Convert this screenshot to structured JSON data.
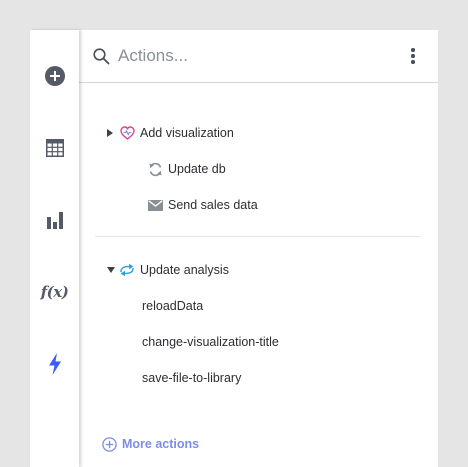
{
  "colors": {
    "background": "#e5e5e5",
    "accent": "#7b8de6",
    "heart": "#e0457b",
    "flow": "#2fa3d9",
    "lightning": "#3d5afe",
    "rail_icon": "#555b66"
  },
  "rail": {
    "items": [
      {
        "name": "add",
        "icon": "plus-circle-icon"
      },
      {
        "name": "table",
        "icon": "table-icon"
      },
      {
        "name": "chart",
        "icon": "bar-chart-icon"
      },
      {
        "name": "function",
        "icon": "fx-icon",
        "glyph": "f(x)"
      },
      {
        "name": "actions",
        "icon": "lightning-icon",
        "active": true
      }
    ]
  },
  "search": {
    "placeholder": "Actions...",
    "value": ""
  },
  "actions": {
    "group1": [
      {
        "label": "Add visualization",
        "icon": "heart-icon",
        "expandable": true,
        "expanded": false
      },
      {
        "label": "Update db",
        "icon": "refresh-icon"
      },
      {
        "label": "Send sales data",
        "icon": "mail-icon"
      }
    ],
    "group2": {
      "label": "Update analysis",
      "icon": "flow-icon",
      "expanded": true,
      "children": [
        "reloadData",
        "change-visualization-title",
        "save-file-to-library"
      ]
    }
  },
  "footer": {
    "more_label": "More actions"
  }
}
